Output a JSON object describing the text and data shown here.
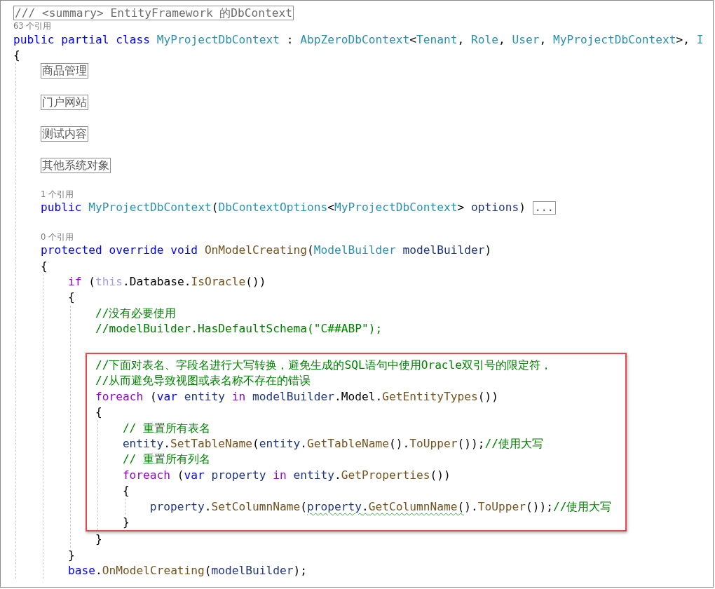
{
  "editor": {
    "lines": [
      {
        "kind": "summary",
        "text": "/// <summary> EntityFramework 的DbContext"
      },
      {
        "kind": "lens",
        "text": "63 个引用"
      },
      {
        "kind": "code",
        "tokens": [
          {
            "text": "public partial class ",
            "kind": "kw"
          },
          {
            "text": "MyProjectDbContext",
            "kind": "type"
          },
          {
            "text": " : ",
            "kind": "plain"
          },
          {
            "text": "AbpZeroDbContext",
            "kind": "type"
          },
          {
            "text": "<",
            "kind": "plain"
          },
          {
            "text": "Tenant",
            "kind": "type"
          },
          {
            "text": ", ",
            "kind": "plain"
          },
          {
            "text": "Role",
            "kind": "type"
          },
          {
            "text": ", ",
            "kind": "plain"
          },
          {
            "text": "User",
            "kind": "type"
          },
          {
            "text": ", ",
            "kind": "plain"
          },
          {
            "text": "MyProjectDbContext",
            "kind": "type"
          },
          {
            "text": ">, ",
            "kind": "plain"
          },
          {
            "text": "I",
            "kind": "type"
          }
        ]
      },
      {
        "kind": "code",
        "tokens": [
          {
            "text": "{",
            "kind": "plain"
          }
        ],
        "children": [
          {
            "kind": "region",
            "text": "商品管理"
          },
          {
            "kind": "blank"
          },
          {
            "kind": "region",
            "text": "门户网站"
          },
          {
            "kind": "blank"
          },
          {
            "kind": "region",
            "text": "测试内容"
          },
          {
            "kind": "blank"
          },
          {
            "kind": "region",
            "text": "其他系统对象"
          },
          {
            "kind": "blank"
          },
          {
            "kind": "lens",
            "text": "1 个引用"
          },
          {
            "kind": "code",
            "tokens": [
              {
                "text": "public ",
                "kind": "kw"
              },
              {
                "text": "MyProjectDbContext",
                "kind": "type"
              },
              {
                "text": "(",
                "kind": "plain"
              },
              {
                "text": "DbContextOptions",
                "kind": "type"
              },
              {
                "text": "<",
                "kind": "plain"
              },
              {
                "text": "MyProjectDbContext",
                "kind": "type"
              },
              {
                "text": "> ",
                "kind": "plain"
              },
              {
                "text": "options",
                "kind": "local"
              },
              {
                "text": ") ",
                "kind": "plain"
              }
            ],
            "folded": "..."
          },
          {
            "kind": "blank"
          },
          {
            "kind": "lens",
            "text": "0 个引用"
          },
          {
            "kind": "code",
            "tokens": [
              {
                "text": "protected override void ",
                "kind": "kw"
              },
              {
                "text": "OnModelCreating",
                "kind": "method"
              },
              {
                "text": "(",
                "kind": "plain"
              },
              {
                "text": "ModelBuilder",
                "kind": "type"
              },
              {
                "text": " modelBuilder",
                "kind": "local"
              },
              {
                "text": ")",
                "kind": "plain"
              }
            ]
          },
          {
            "kind": "code",
            "tokens": [
              {
                "text": "{",
                "kind": "plain"
              }
            ],
            "children": [
              {
                "kind": "code",
                "tokens": [
                  {
                    "text": "if",
                    "kind": "ctl"
                  },
                  {
                    "text": " (",
                    "kind": "plain"
                  },
                  {
                    "text": "this",
                    "kind": "faded"
                  },
                  {
                    "text": ".Database.",
                    "kind": "plain"
                  },
                  {
                    "text": "IsOracle",
                    "kind": "method"
                  },
                  {
                    "text": "())",
                    "kind": "plain"
                  }
                ]
              },
              {
                "kind": "code",
                "tokens": [
                  {
                    "text": "{",
                    "kind": "plain"
                  }
                ],
                "children": [
                  {
                    "kind": "code",
                    "tokens": [
                      {
                        "text": "//没有必要使用",
                        "kind": "comment"
                      }
                    ]
                  },
                  {
                    "kind": "code",
                    "tokens": [
                      {
                        "text": "//modelBuilder.HasDefaultSchema(\"C##ABP\");",
                        "kind": "comment"
                      }
                    ]
                  },
                  {
                    "kind": "blank"
                  },
                  {
                    "kind": "highlight",
                    "children": [
                      {
                        "kind": "code",
                        "tokens": [
                          {
                            "text": "//下面对表名、字段名进行大写转换，避免生成的SQL语句中使用Oracle双引号的限定符，",
                            "kind": "comment"
                          }
                        ]
                      },
                      {
                        "kind": "code",
                        "tokens": [
                          {
                            "text": "//从而避免导致视图或表名称不存在的错误",
                            "kind": "comment"
                          }
                        ]
                      },
                      {
                        "kind": "code",
                        "tokens": [
                          {
                            "text": "foreach",
                            "kind": "ctl"
                          },
                          {
                            "text": " (",
                            "kind": "plain"
                          },
                          {
                            "text": "var",
                            "kind": "kw"
                          },
                          {
                            "text": " entity",
                            "kind": "local"
                          },
                          {
                            "text": " in",
                            "kind": "ctl"
                          },
                          {
                            "text": " modelBuilder",
                            "kind": "local"
                          },
                          {
                            "text": ".Model.",
                            "kind": "plain"
                          },
                          {
                            "text": "GetEntityTypes",
                            "kind": "method"
                          },
                          {
                            "text": "())",
                            "kind": "plain"
                          }
                        ]
                      },
                      {
                        "kind": "code",
                        "tokens": [
                          {
                            "text": "{",
                            "kind": "plain"
                          }
                        ],
                        "children": [
                          {
                            "kind": "code",
                            "tokens": [
                              {
                                "text": "// 重置所有表名",
                                "kind": "comment"
                              }
                            ]
                          },
                          {
                            "kind": "code",
                            "tokens": [
                              {
                                "text": "entity",
                                "kind": "local"
                              },
                              {
                                "text": ".",
                                "kind": "plain"
                              },
                              {
                                "text": "SetTableName",
                                "kind": "method"
                              },
                              {
                                "text": "(",
                                "kind": "plain"
                              },
                              {
                                "text": "entity",
                                "kind": "local"
                              },
                              {
                                "text": ".",
                                "kind": "plain"
                              },
                              {
                                "text": "GetTableName",
                                "kind": "method"
                              },
                              {
                                "text": "().",
                                "kind": "plain"
                              },
                              {
                                "text": "ToUpper",
                                "kind": "method"
                              },
                              {
                                "text": "());",
                                "kind": "plain"
                              },
                              {
                                "text": "//使用大写",
                                "kind": "comment"
                              }
                            ]
                          },
                          {
                            "kind": "code",
                            "tokens": [
                              {
                                "text": "// 重置所有列名",
                                "kind": "comment"
                              }
                            ]
                          },
                          {
                            "kind": "code",
                            "tokens": [
                              {
                                "text": "foreach",
                                "kind": "ctl"
                              },
                              {
                                "text": " (",
                                "kind": "plain"
                              },
                              {
                                "text": "var",
                                "kind": "kw"
                              },
                              {
                                "text": " property",
                                "kind": "local"
                              },
                              {
                                "text": " in",
                                "kind": "ctl"
                              },
                              {
                                "text": " entity",
                                "kind": "local"
                              },
                              {
                                "text": ".",
                                "kind": "plain"
                              },
                              {
                                "text": "GetProperties",
                                "kind": "method"
                              },
                              {
                                "text": "())",
                                "kind": "plain"
                              }
                            ]
                          },
                          {
                            "kind": "code",
                            "tokens": [
                              {
                                "text": "{",
                                "kind": "plain"
                              }
                            ],
                            "children": [
                              {
                                "kind": "code",
                                "tokens": [
                                  {
                                    "text": "property",
                                    "kind": "local",
                                    "squiggle": false
                                  },
                                  {
                                    "text": ".",
                                    "kind": "plain",
                                    "squiggle": false
                                  },
                                  {
                                    "text": "SetColumnName",
                                    "kind": "method",
                                    "squiggle": false
                                  },
                                  {
                                    "text": "(",
                                    "kind": "plain",
                                    "squiggle": false
                                  },
                                  {
                                    "text": "property",
                                    "kind": "local",
                                    "squiggle": true
                                  },
                                  {
                                    "text": ".",
                                    "kind": "plain",
                                    "squiggle": true
                                  },
                                  {
                                    "text": "GetColumnName",
                                    "kind": "method",
                                    "squiggle": true
                                  },
                                  {
                                    "text": "(",
                                    "kind": "plain",
                                    "squiggle": true
                                  },
                                  {
                                    "text": ").",
                                    "kind": "plain",
                                    "squiggle": false
                                  },
                                  {
                                    "text": "ToUpper",
                                    "kind": "method",
                                    "squiggle": false
                                  },
                                  {
                                    "text": "());",
                                    "kind": "plain",
                                    "squiggle": false
                                  },
                                  {
                                    "text": "//使用大写",
                                    "kind": "comment",
                                    "squiggle": false
                                  }
                                ]
                              }
                            ]
                          },
                          {
                            "kind": "code",
                            "tokens": [
                              {
                                "text": "}",
                                "kind": "plain"
                              }
                            ]
                          }
                        ]
                      }
                    ]
                  },
                  {
                    "kind": "code",
                    "tokens": [
                      {
                        "text": "}",
                        "kind": "plain"
                      }
                    ]
                  }
                ]
              },
              {
                "kind": "code",
                "tokens": [
                  {
                    "text": "}",
                    "kind": "plain"
                  }
                ]
              },
              {
                "kind": "code",
                "tokens": [
                  {
                    "text": "base",
                    "kind": "kw"
                  },
                  {
                    "text": ".",
                    "kind": "plain"
                  },
                  {
                    "text": "OnModelCreating",
                    "kind": "method"
                  },
                  {
                    "text": "(",
                    "kind": "plain"
                  },
                  {
                    "text": "modelBuilder",
                    "kind": "local"
                  },
                  {
                    "text": ");",
                    "kind": "plain"
                  }
                ]
              }
            ]
          }
        ]
      }
    ]
  }
}
